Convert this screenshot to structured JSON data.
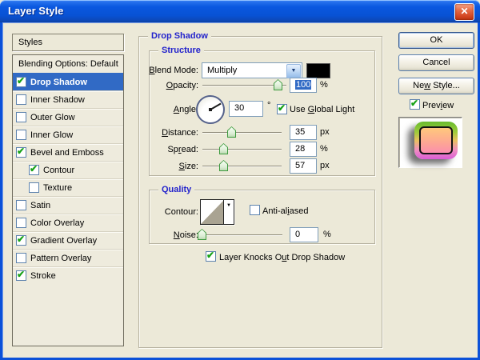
{
  "window": {
    "title": "Layer Style"
  },
  "icons": {
    "close": "✕",
    "dropdown": "▼",
    "contour_dropdown": "▼"
  },
  "colors": {
    "dialog_bg": "#ece9d8",
    "selection_blue": "#316ac5",
    "titlebar_blue": "#0855dd",
    "group_label_blue": "#2323cc",
    "blend_swatch": "#000000",
    "contour_gray": "#a9a392"
  },
  "sidebar": {
    "header": "Styles",
    "items": [
      {
        "label": "Blending Options: Default",
        "checkbox": false
      },
      {
        "label": "Drop Shadow",
        "checked": true,
        "selected": true
      },
      {
        "label": "Inner Shadow",
        "checked": false
      },
      {
        "label": "Outer Glow",
        "checked": false
      },
      {
        "label": "Inner Glow",
        "checked": false
      },
      {
        "label": "Bevel and Emboss",
        "checked": true
      },
      {
        "label": "Contour",
        "checked": true,
        "indent": true
      },
      {
        "label": "Texture",
        "checked": false,
        "indent": true
      },
      {
        "label": "Satin",
        "checked": false
      },
      {
        "label": "Color Overlay",
        "checked": false
      },
      {
        "label": "Gradient Overlay",
        "checked": true
      },
      {
        "label": "Pattern Overlay",
        "checked": false
      },
      {
        "label": "Stroke",
        "checked": true
      }
    ]
  },
  "panel": {
    "title": "Drop Shadow",
    "structure": {
      "title": "Structure",
      "blend_mode": {
        "label": "_B_lend Mode:",
        "value": "Multiply"
      },
      "opacity": {
        "label": "_O_pacity:",
        "value": "100",
        "unit": "%"
      },
      "angle": {
        "label": "_A_ngle:",
        "value": "30",
        "unit": "°",
        "global_light_label": "Use _G_lobal Light",
        "global_light_checked": true
      },
      "distance": {
        "label": "_D_istance:",
        "value": "35",
        "unit": "px"
      },
      "spread": {
        "label": "Sp_r_ead:",
        "value": "28",
        "unit": "%"
      },
      "size": {
        "label": "_S_ize:",
        "value": "57",
        "unit": "px"
      }
    },
    "quality": {
      "title": "Quality",
      "contour_label": "Contour:",
      "anti_aliased_label": "Anti-al_i_ased",
      "anti_aliased_checked": false,
      "noise": {
        "label": "_N_oise:",
        "value": "0",
        "unit": "%"
      }
    },
    "knockout_label": "Layer Knocks O_u_t Drop Shadow",
    "knockout_checked": true
  },
  "actions": {
    "ok": "OK",
    "cancel": "Cancel",
    "new_style": "Ne_w_ Style...",
    "preview_label": "Prev_i_ew",
    "preview_checked": true
  }
}
